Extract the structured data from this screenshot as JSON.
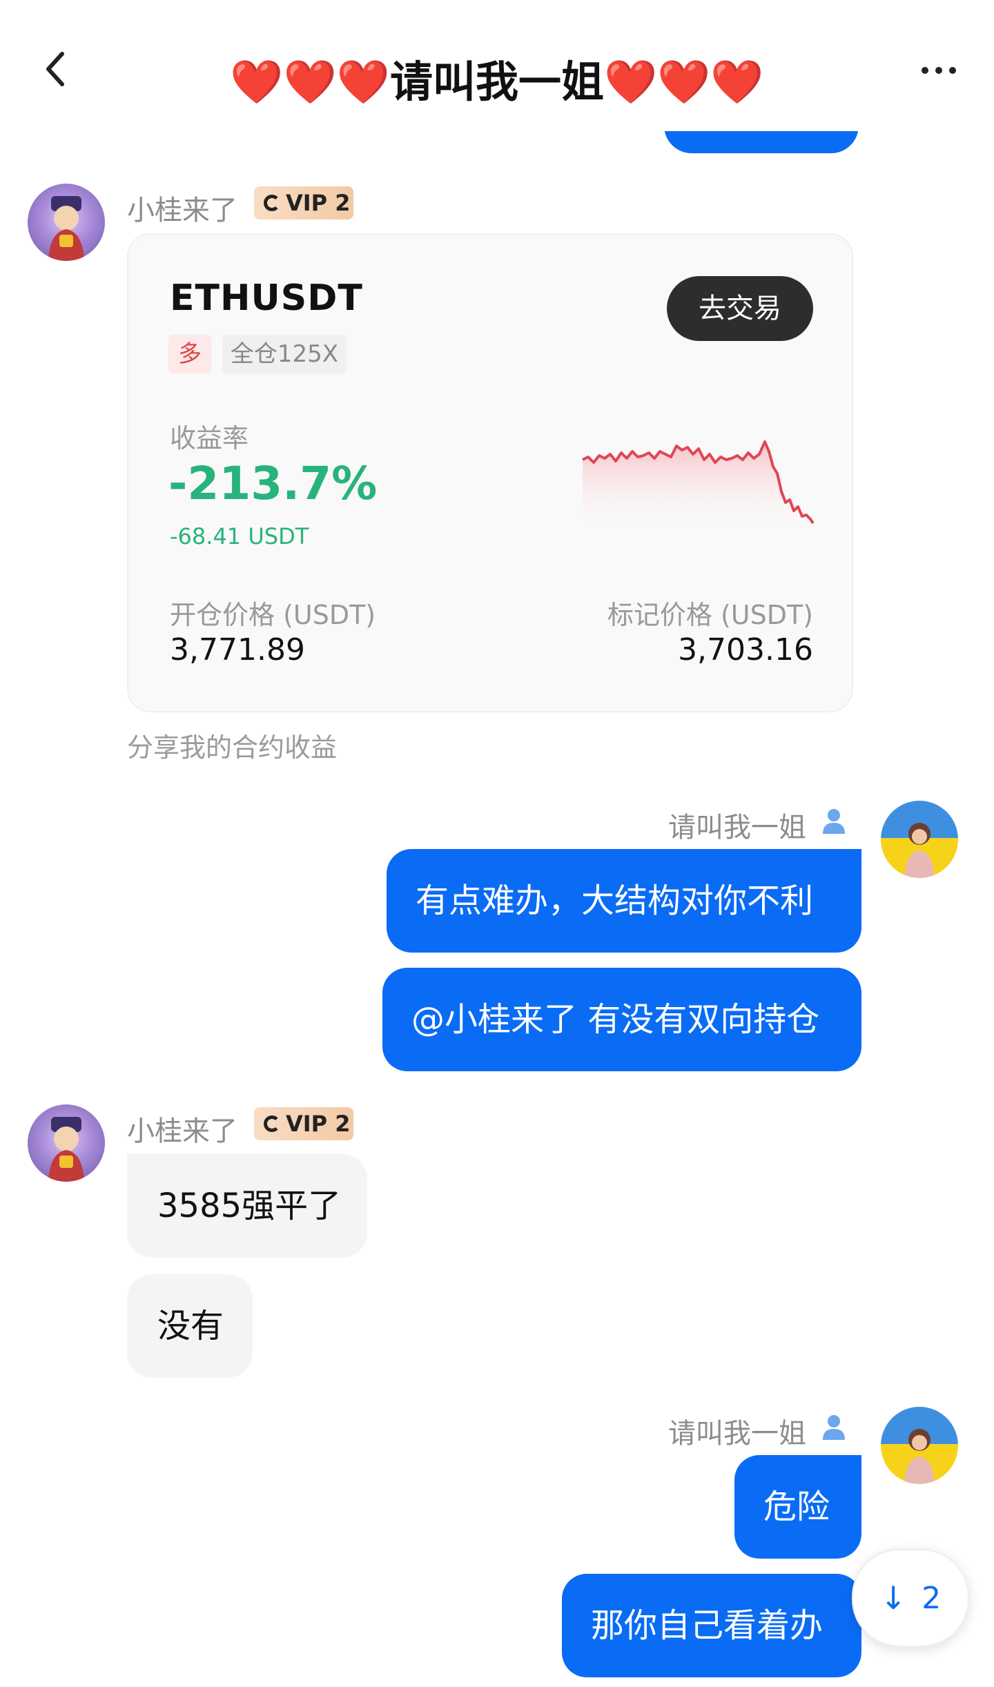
{
  "header": {
    "title_hearts_left": "❤️❤️❤️",
    "title_text": "请叫我一姐",
    "title_hearts_right": "❤️❤️❤️",
    "back_icon": "chevron-left-icon",
    "more_icon": "more-dots-icon"
  },
  "messages": {
    "other_sender": "小桂来了",
    "vip_badge": "VIP 2",
    "self_sender": "请叫我一姐",
    "card": {
      "pair": "ETHUSDT",
      "side_tag": "多",
      "leverage_tag": "全仓125X",
      "trade_button": "去交易",
      "roe_label": "收益率",
      "roe_value": "-213.7%",
      "pnl_value": "-68.41 USDT",
      "open_price_label": "开仓价格 (USDT)",
      "open_price": "3,771.89",
      "mark_price_label": "标记价格 (USDT)",
      "mark_price": "3,703.16",
      "caption": "分享我的合约收益"
    },
    "self_msg_1": "有点难办，大结构对你不利",
    "self_msg_2": "@小桂来了 有没有双向持仓",
    "other_msg_1": "3585强平了",
    "other_msg_2": "没有",
    "self_msg_3": "危险",
    "self_msg_4": "那你自己看着办"
  },
  "scroll_button": {
    "count": "2",
    "icon": "arrow-down-icon"
  },
  "colors": {
    "self_bubble": "#0a6cf5",
    "other_bubble": "#f3f4f6",
    "profit_negative": "#28b37d",
    "spark_line": "#e04655"
  }
}
